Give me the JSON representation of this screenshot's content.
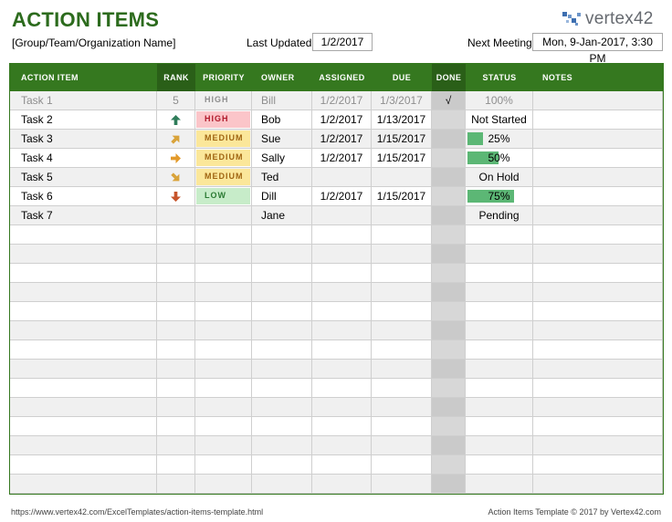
{
  "header": {
    "title": "ACTION ITEMS",
    "subtitle": "[Group/Team/Organization Name]",
    "last_updated_label": "Last Updated:",
    "last_updated_value": "1/2/2017",
    "next_meeting_label": "Next Meeting:",
    "next_meeting_value": "Mon, 9-Jan-2017, 3:30 PM",
    "logo_text": "vertex42"
  },
  "columns": [
    "ACTION ITEM",
    "RANK",
    "PRIORITY",
    "OWNER",
    "ASSIGNED",
    "DUE",
    "DONE",
    "STATUS",
    "NOTES"
  ],
  "rows": [
    {
      "item": "Task 1",
      "rank": "5",
      "rank_icon": "",
      "priority": "HIGH",
      "priority_level": "grey",
      "owner": "Bill",
      "assigned": "1/2/2017",
      "due": "1/3/2017",
      "done": "√",
      "status": "100%",
      "progress": 0,
      "notes": "",
      "completed": true
    },
    {
      "item": "Task 2",
      "rank": "",
      "rank_icon": "arrow-up-icon",
      "priority": "HIGH",
      "priority_level": "high",
      "owner": "Bob",
      "assigned": "1/2/2017",
      "due": "1/13/2017",
      "done": "",
      "status": "Not Started",
      "progress": 0,
      "notes": ""
    },
    {
      "item": "Task 3",
      "rank": "",
      "rank_icon": "arrow-up-right-icon",
      "priority": "MEDIUM",
      "priority_level": "medium",
      "owner": "Sue",
      "assigned": "1/2/2017",
      "due": "1/15/2017",
      "done": "",
      "status": "25%",
      "progress": 0.25,
      "notes": ""
    },
    {
      "item": "Task 4",
      "rank": "",
      "rank_icon": "arrow-right-icon",
      "priority": "MEDIUM",
      "priority_level": "medium",
      "owner": "Sally",
      "assigned": "1/2/2017",
      "due": "1/15/2017",
      "done": "",
      "status": "50%",
      "progress": 0.5,
      "notes": ""
    },
    {
      "item": "Task 5",
      "rank": "",
      "rank_icon": "arrow-down-right-icon",
      "priority": "MEDIUM",
      "priority_level": "medium",
      "owner": "Ted",
      "assigned": "",
      "due": "",
      "done": "",
      "status": "On Hold",
      "progress": 0,
      "notes": ""
    },
    {
      "item": "Task 6",
      "rank": "",
      "rank_icon": "arrow-down-icon",
      "priority": "LOW",
      "priority_level": "low",
      "owner": "Dill",
      "assigned": "1/2/2017",
      "due": "1/15/2017",
      "done": "",
      "status": "75%",
      "progress": 0.75,
      "notes": ""
    },
    {
      "item": "Task 7",
      "rank": "",
      "rank_icon": "",
      "priority": "",
      "priority_level": "",
      "owner": "Jane",
      "assigned": "",
      "due": "",
      "done": "",
      "status": "Pending",
      "progress": 0,
      "notes": ""
    }
  ],
  "footer": {
    "url": "https://www.vertex42.com/ExcelTemplates/action-items-template.html",
    "copyright": "Action Items Template © 2017 by Vertex42.com"
  },
  "colors": {
    "header_green": "#35781f",
    "title_green": "#2c6b1d",
    "high": "#fbc5c9",
    "medium": "#fbe79a",
    "low": "#c7ecc9",
    "progress": "#5cb775"
  }
}
